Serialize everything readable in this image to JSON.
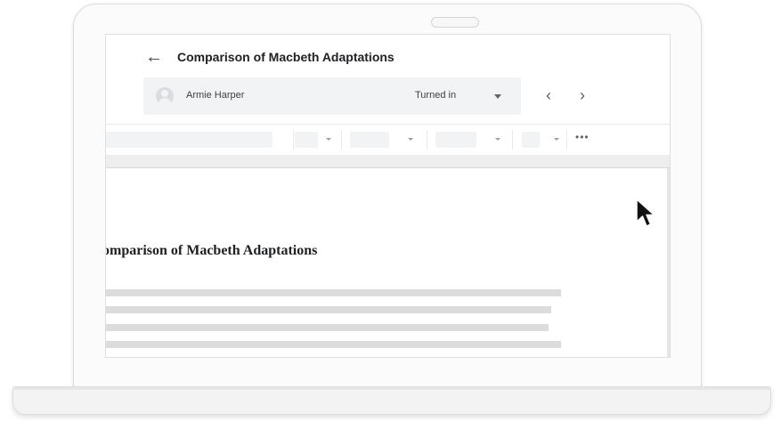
{
  "document": {
    "title": "Comparison of Macbeth Adaptations",
    "heading": "omparison of Macbeth Adaptations"
  },
  "student": {
    "name": "Armie Harper",
    "status": "Turned in"
  },
  "icons": {
    "back": "arrow-left-icon",
    "prev": "chevron-left-icon",
    "next": "chevron-right-icon",
    "avatar": "account-circle-icon",
    "more": "more-horizontal-icon",
    "pointer": "mouse-pointer-icon"
  },
  "glyphs": {
    "back": "←",
    "prev": "‹",
    "next": "›",
    "more": "•••"
  },
  "colors": {
    "text": "#202124",
    "secondary": "#5f6368",
    "bar": "#f1f3f4"
  }
}
